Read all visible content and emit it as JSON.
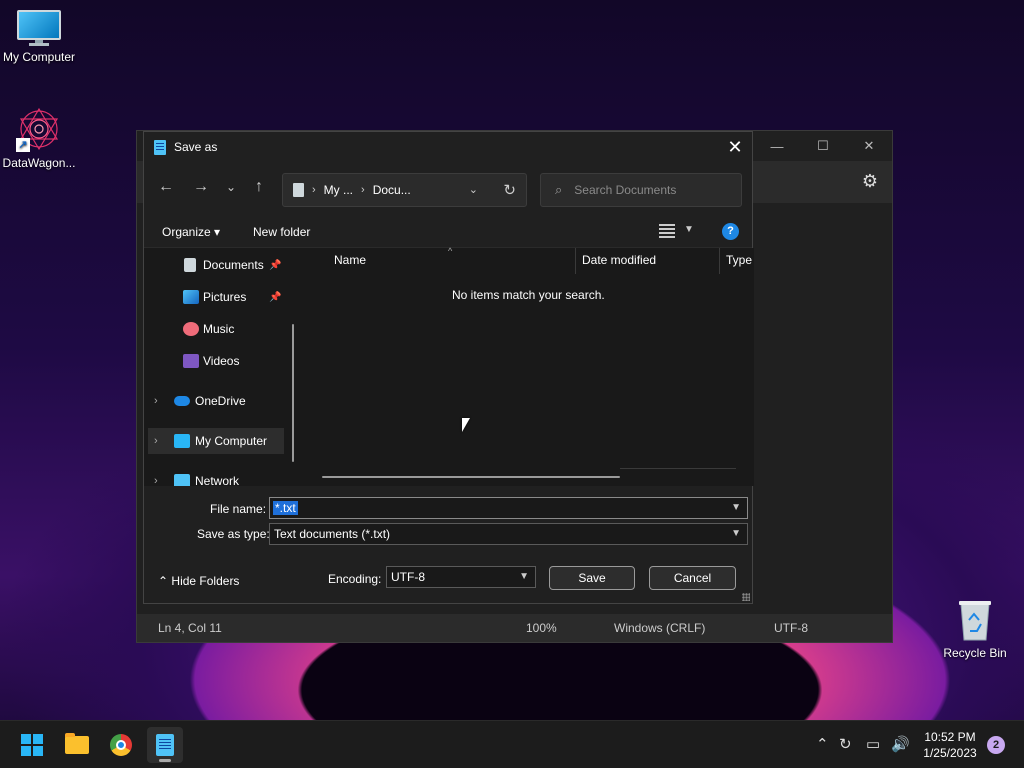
{
  "desktop": {
    "icons": [
      {
        "label": "My Computer"
      },
      {
        "label": "DataWagon..."
      },
      {
        "label": "Recycle Bin"
      }
    ]
  },
  "notepad": {
    "status": {
      "position": "Ln 4, Col 11",
      "zoom": "100%",
      "line_ending": "Windows (CRLF)",
      "encoding": "UTF-8"
    }
  },
  "dialog": {
    "title": "Save as",
    "address": {
      "part1": "My ...",
      "part2": "Docu..."
    },
    "search_placeholder": "Search Documents",
    "toolbar": {
      "organize": "Organize ▾",
      "new_folder": "New folder"
    },
    "nav": {
      "documents": "Documents",
      "pictures": "Pictures",
      "music": "Music",
      "videos": "Videos",
      "onedrive": "OneDrive",
      "my_computer": "My Computer",
      "network": "Network"
    },
    "columns": {
      "name": "Name",
      "date_modified": "Date modified",
      "type": "Type"
    },
    "empty_message": "No items match your search.",
    "file_name_label": "File name:",
    "file_name_value": "*.txt",
    "save_type_label": "Save as type:",
    "save_type_value": "Text documents (*.txt)",
    "hide_folders": "Hide Folders",
    "encoding_label": "Encoding:",
    "encoding_value": "UTF-8",
    "save": "Save",
    "cancel": "Cancel"
  },
  "taskbar": {
    "time": "10:52 PM",
    "date": "1/25/2023",
    "notification_count": "2"
  }
}
